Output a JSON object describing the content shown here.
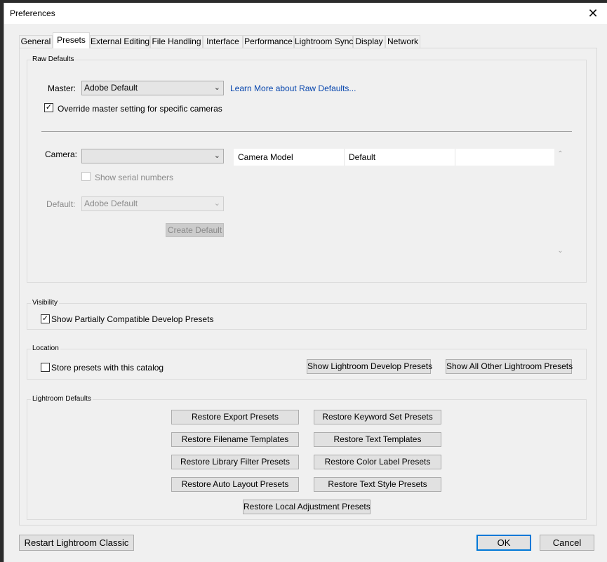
{
  "window": {
    "title": "Preferences",
    "close_icon": "close-icon"
  },
  "tabs": [
    "General",
    "Presets",
    "External Editing",
    "File Handling",
    "Interface",
    "Performance",
    "Lightroom Sync",
    "Display",
    "Network"
  ],
  "active_tab": "Presets",
  "raw_defaults": {
    "title": "Raw Defaults",
    "master_label": "Master:",
    "master_value": "Adobe Default",
    "learn_more": "Learn More about Raw Defaults...",
    "override_label": "Override master setting for specific cameras",
    "override_checked": true,
    "camera_label": "Camera:",
    "camera_value": "",
    "show_serial_label": "Show serial numbers",
    "show_serial_checked": false,
    "default_label": "Default:",
    "default_value": "Adobe Default",
    "create_default": "Create Default",
    "table_headers": [
      "Camera Model",
      "Default"
    ]
  },
  "visibility": {
    "title": "Visibility",
    "show_partial_label": "Show Partially Compatible Develop Presets",
    "show_partial_checked": true
  },
  "location": {
    "title": "Location",
    "store_label": "Store presets with this catalog",
    "store_checked": false,
    "show_develop": "Show Lightroom Develop Presets",
    "show_other": "Show All Other Lightroom Presets"
  },
  "lightroom_defaults": {
    "title": "Lightroom Defaults",
    "restore_export": "Restore Export Presets",
    "restore_keyword": "Restore Keyword Set Presets",
    "restore_filename": "Restore Filename Templates",
    "restore_text": "Restore Text Templates",
    "restore_library": "Restore Library Filter Presets",
    "restore_color": "Restore Color Label Presets",
    "restore_autolayout": "Restore Auto Layout Presets",
    "restore_textstyle": "Restore Text Style Presets",
    "restore_local": "Restore Local Adjustment Presets"
  },
  "footer": {
    "restart": "Restart Lightroom Classic",
    "ok": "OK",
    "cancel": "Cancel"
  },
  "icons": {
    "check": "✓",
    "chevron_down": "⌄",
    "close": "✕",
    "scroll_up": "⌃",
    "scroll_down": "⌄"
  }
}
